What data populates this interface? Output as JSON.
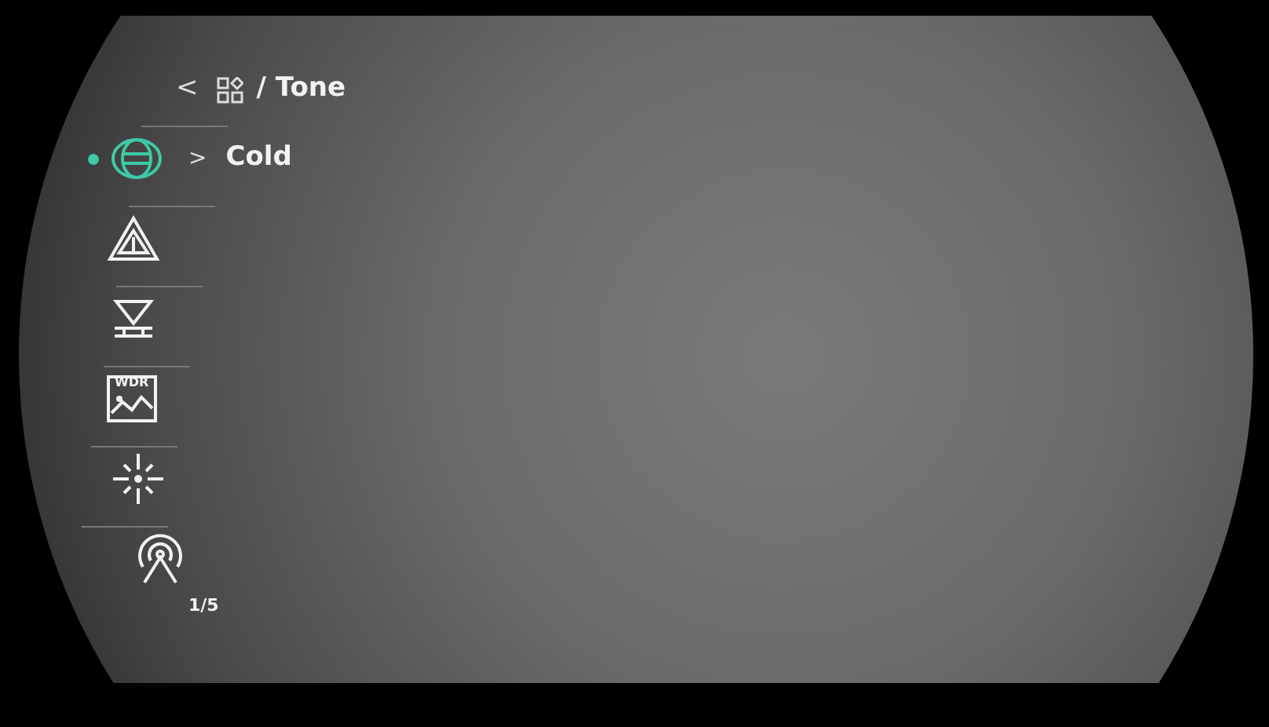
{
  "header": {
    "back": "<",
    "title": "/ Tone"
  },
  "menu_items": [
    {
      "kind": "tone",
      "selected": true,
      "value_arrow": ">",
      "value": "Cold"
    },
    {
      "kind": "alert",
      "selected": false
    },
    {
      "kind": "calibrate",
      "selected": false
    },
    {
      "kind": "wdr",
      "selected": false,
      "icon_text": "WDR"
    },
    {
      "kind": "brightness",
      "selected": false
    },
    {
      "kind": "hotspot",
      "selected": false
    }
  ],
  "page_indicator": "1/5"
}
